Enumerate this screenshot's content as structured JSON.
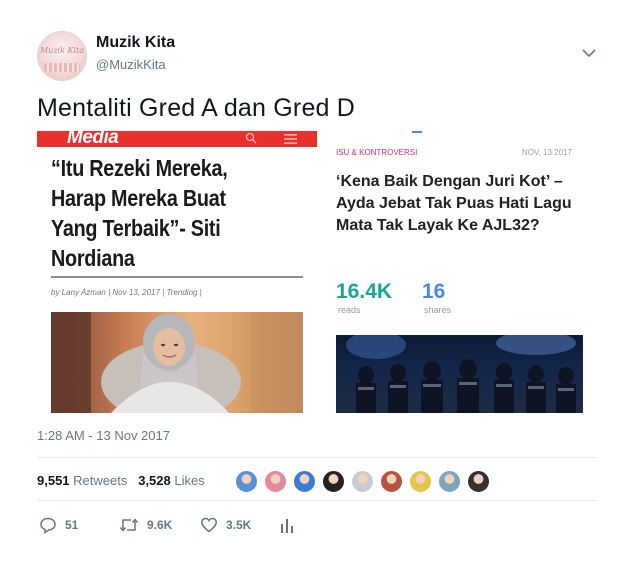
{
  "user": {
    "display_name": "Muzik Kita",
    "handle": "@MuzikKita",
    "avatar_text": "Muzik Kita",
    "avatar_icon": "profile-logo"
  },
  "tweet": {
    "text": "Mentaliti Gred A dan Gred D",
    "timestamp": "1:28 AM - 13 Nov 2017"
  },
  "card_left": {
    "brand": "Media",
    "headline": "“Itu Rezeki Mereka, Harap Mereka Buat Yang Terbaik”- Siti Nordiana",
    "byline": "by Lany Azman | Nov 13, 2017 | Trending |"
  },
  "card_right": {
    "category": "ISU & KONTROVERSI",
    "date": "NOV, 13 2017",
    "title": "‘Kena Baik Dengan Juri Kot’ – Ayda Jebat Tak Puas Hati Lagu Mata Tak Layak Ke AJL32?",
    "reads_value": "16.4K",
    "reads_label": "reads",
    "shares_value": "16",
    "shares_label": "shares"
  },
  "stats": {
    "retweets_count": "9,551",
    "retweets_label": "Retweets",
    "likes_count": "3,528",
    "likes_label": "Likes"
  },
  "likers": [
    "#5b8fd6",
    "#e48aa0",
    "#3a7bd5",
    "#222222",
    "#c8ccd1",
    "#b5533f",
    "#e3c64a",
    "#7fa5b8",
    "#333333"
  ],
  "actions": {
    "replies": "51",
    "retweets": "9.6K",
    "likes": "3.5K"
  },
  "colors": {
    "accent_red": "#e8302c",
    "reads_teal": "#1aa59b",
    "shares_blue": "#4a89dc",
    "muted": "#657786"
  }
}
